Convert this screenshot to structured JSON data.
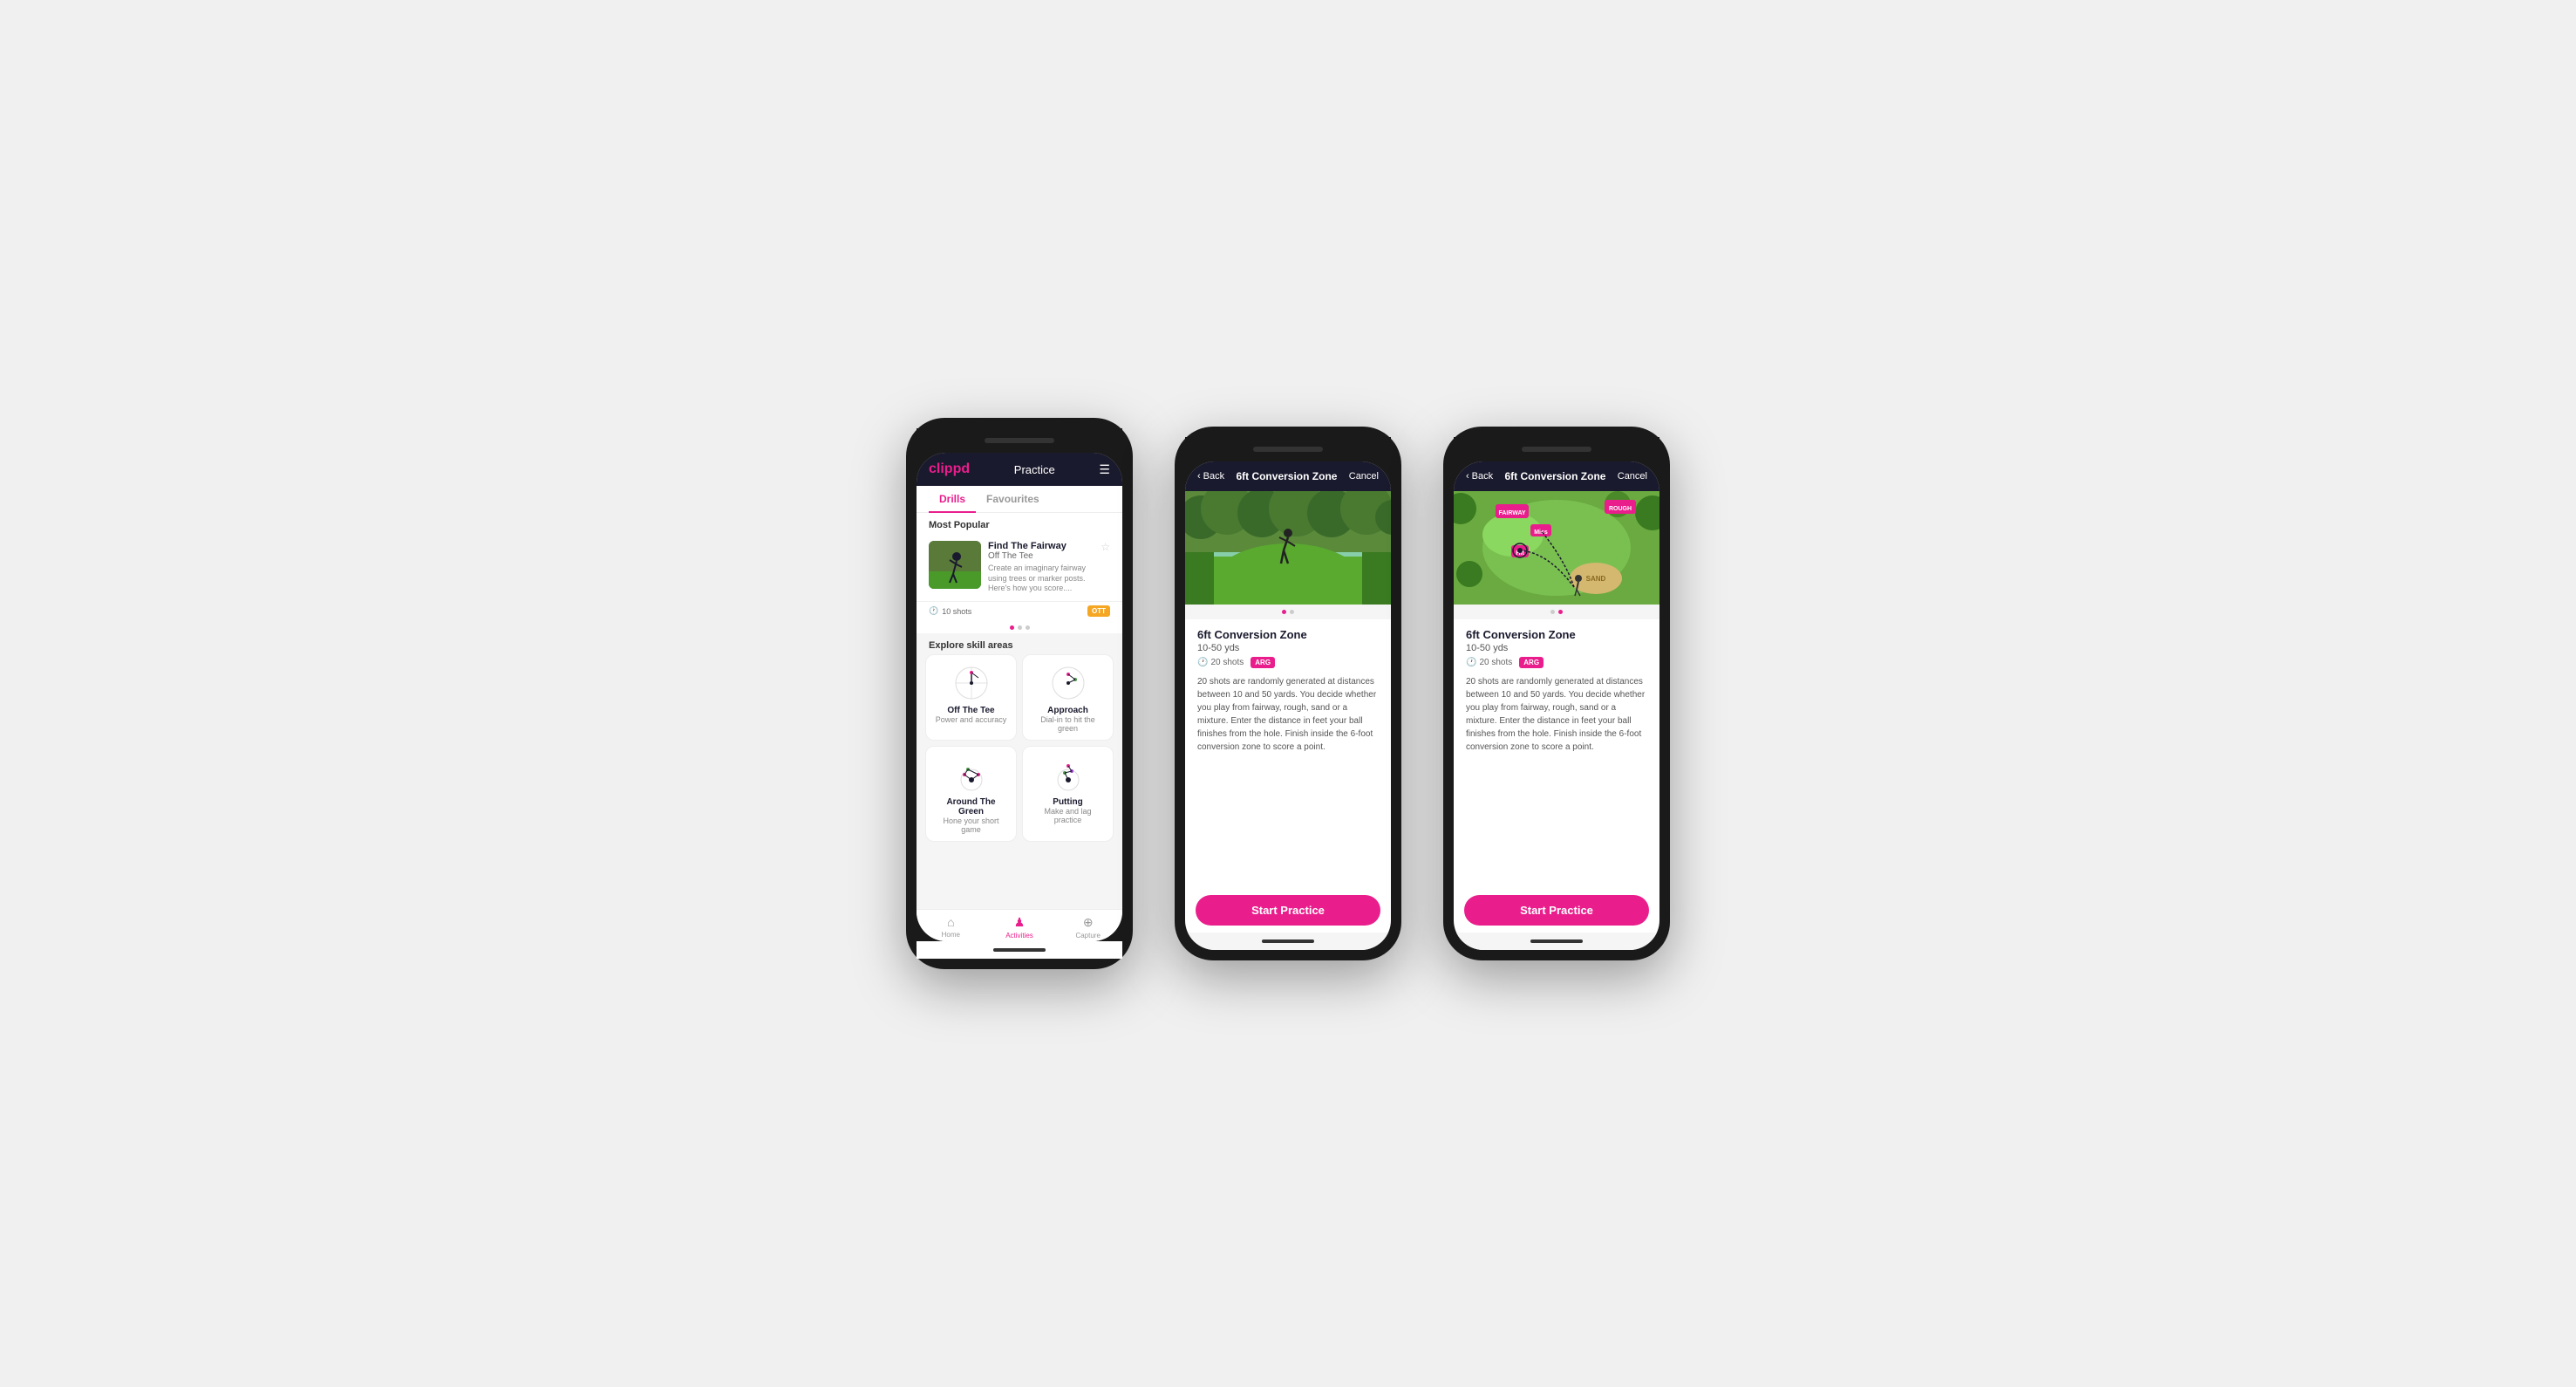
{
  "phone1": {
    "header": {
      "logo": "clippd",
      "title": "Practice",
      "menu_icon": "☰"
    },
    "tabs": [
      {
        "label": "Drills",
        "active": true
      },
      {
        "label": "Favourites",
        "active": false
      }
    ],
    "most_popular_label": "Most Popular",
    "featured_drill": {
      "title": "Find The Fairway",
      "subtitle": "Off The Tee",
      "description": "Create an imaginary fairway using trees or marker posts. Here's how you score....",
      "shots": "10 shots",
      "badge": "OTT"
    },
    "dots": [
      "active",
      "inactive",
      "inactive"
    ],
    "explore_label": "Explore skill areas",
    "skills": [
      {
        "name": "Off The Tee",
        "desc": "Power and accuracy"
      },
      {
        "name": "Approach",
        "desc": "Dial-in to hit the green"
      },
      {
        "name": "Around The Green",
        "desc": "Hone your short game"
      },
      {
        "name": "Putting",
        "desc": "Make and lag practice"
      }
    ],
    "nav": [
      {
        "label": "Home",
        "icon": "⌂",
        "active": false
      },
      {
        "label": "Activities",
        "icon": "♟",
        "active": true
      },
      {
        "label": "Capture",
        "icon": "⊕",
        "active": false
      }
    ]
  },
  "phone2": {
    "header": {
      "back": "Back",
      "title": "6ft Conversion Zone",
      "cancel": "Cancel"
    },
    "drill": {
      "title": "6ft Conversion Zone",
      "distance": "10-50 yds",
      "shots": "20 shots",
      "badge": "ARG",
      "description": "20 shots are randomly generated at distances between 10 and 50 yards. You decide whether you play from fairway, rough, sand or a mixture. Enter the distance in feet your ball finishes from the hole. Finish inside the 6-foot conversion zone to score a point."
    },
    "dots": [
      "active",
      "inactive"
    ],
    "start_btn": "Start Practice"
  },
  "phone3": {
    "header": {
      "back": "Back",
      "title": "6ft Conversion Zone",
      "cancel": "Cancel"
    },
    "drill": {
      "title": "6ft Conversion Zone",
      "distance": "10-50 yds",
      "shots": "20 shots",
      "badge": "ARG",
      "description": "20 shots are randomly generated at distances between 10 and 50 yards. You decide whether you play from fairway, rough, sand or a mixture. Enter the distance in feet your ball finishes from the hole. Finish inside the 6-foot conversion zone to score a point."
    },
    "dots": [
      "inactive",
      "active"
    ],
    "start_btn": "Start Practice"
  }
}
